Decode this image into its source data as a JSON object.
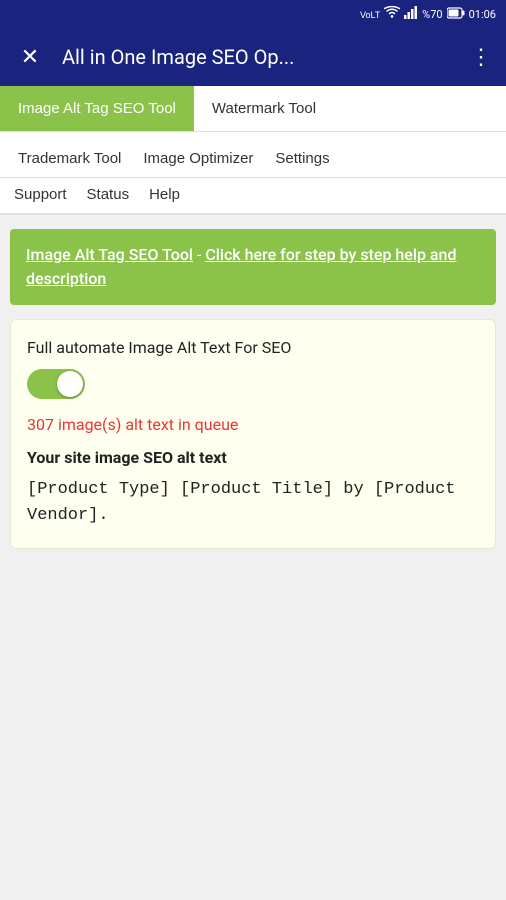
{
  "statusBar": {
    "network": "VoLTE",
    "wifi": "wifi",
    "signal": "signal",
    "battery": "%70",
    "time": "01:06"
  },
  "appBar": {
    "title": "All in One Image SEO Op...",
    "closeIcon": "✕",
    "menuIcon": "⋮"
  },
  "primaryTabs": [
    {
      "label": "Image Alt Tag SEO Tool",
      "active": true
    },
    {
      "label": "Watermark Tool",
      "active": false
    }
  ],
  "secondaryNav": [
    {
      "label": "Trademark Tool"
    },
    {
      "label": "Image Optimizer"
    },
    {
      "label": "Settings"
    }
  ],
  "thirdNav": [
    {
      "label": "Support"
    },
    {
      "label": "Status"
    },
    {
      "label": "Help"
    }
  ],
  "banner": {
    "toolName": "Image Alt Tag SEO Tool",
    "separator": " - ",
    "linkText": "Click here for step by step help and description"
  },
  "mainCard": {
    "automateLabel": "Full automate Image Alt Text For SEO",
    "toggleOn": true,
    "queueText": "307 image(s) alt text in queue",
    "seoLabel": "Your site image SEO alt text",
    "seoValue": "[Product Type] [Product Title] by [Product Vendor]."
  }
}
